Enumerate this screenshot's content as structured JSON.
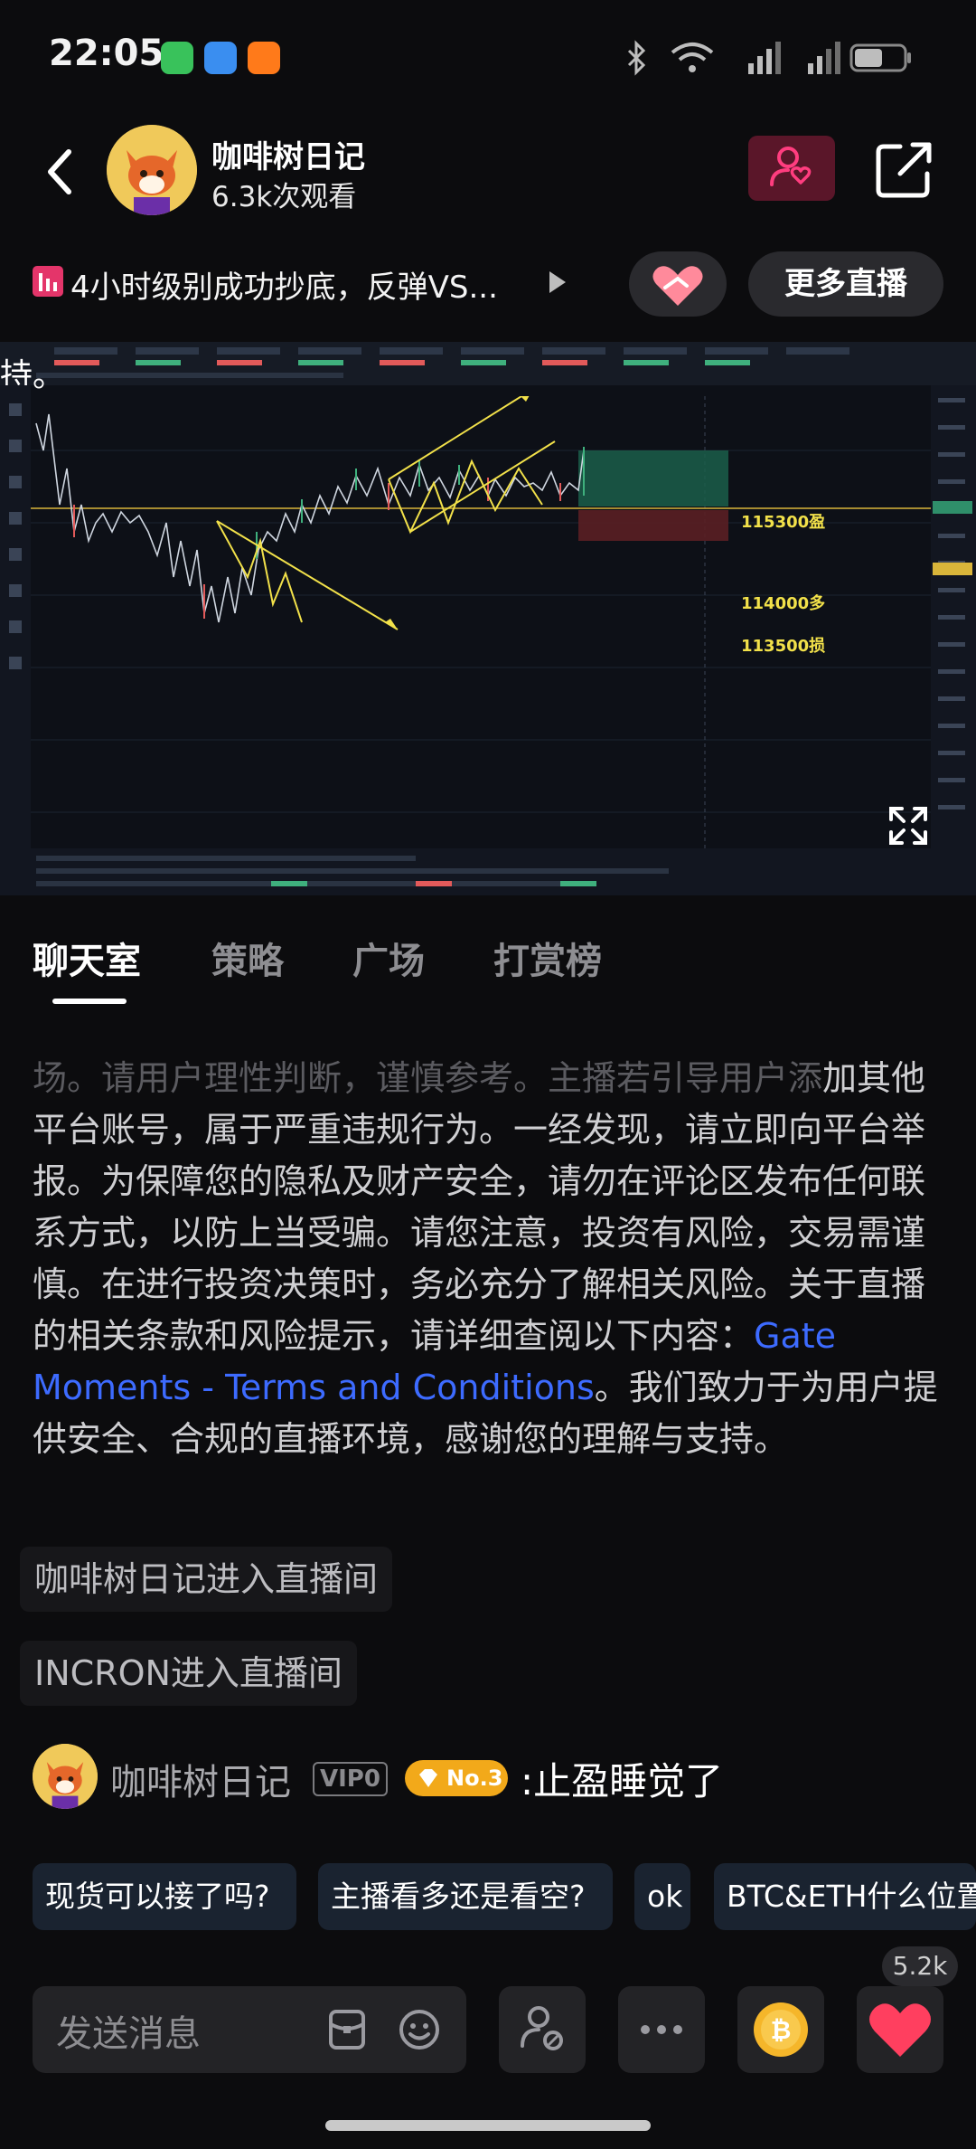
{
  "status": {
    "time": "22:05"
  },
  "header": {
    "host_name": "咖啡树日记",
    "views": "6.3k次观看"
  },
  "title_row": {
    "title": "4小时级别成功抄底，反弹VS...",
    "more_live_label": "更多直播"
  },
  "video": {
    "overlay_text": "持。",
    "price_labels": {
      "take_profit": "115300盈",
      "entry": "114000多",
      "stop_loss": "113500损"
    },
    "colors": {
      "profit_zone": "#1b5e4a",
      "loss_zone": "#5a1f24",
      "annotation": "#f2e14a"
    }
  },
  "tabs": [
    {
      "label": "聊天室"
    },
    {
      "label": "策略"
    },
    {
      "label": "广场"
    },
    {
      "label": "打赏榜"
    }
  ],
  "chat": {
    "notice_fade": "场。请用户理性判断，谨慎参考。主播若引导用户添",
    "notice_body": "加其他平台账号，属于严重违规行为。一经发现，请立即向平台举报。为保障您的隐私及财产安全，请勿在评论区发布任何联系方式，以防上当受骗。请您注意，投资有风险，交易需谨慎。在进行投资决策时，务必充分了解相关风险。关于直播的相关条款和风险提示，请详细查阅以下内容：",
    "notice_link": "Gate Moments - Terms and Conditions",
    "notice_tail": "。我们致力于为用户提供安全、合规的直播环境，感谢您的理解与支持。",
    "system_messages": [
      {
        "text": "咖啡树日记进入直播间"
      },
      {
        "text": "INCRON进入直播间"
      }
    ],
    "message": {
      "user": "咖啡树日记",
      "vip": "VIP0",
      "rank": "No.3",
      "text": ":止盈睡觉了"
    }
  },
  "quick_replies": [
    {
      "label": "现货可以接了吗?"
    },
    {
      "label": "主播看多还是看空?"
    },
    {
      "label": "ok"
    },
    {
      "label": "BTC&ETH什么位置"
    }
  ],
  "bottom_bar": {
    "like_count": "5.2k",
    "input_placeholder": "发送消息"
  },
  "theme": {
    "background": "#0c0c0e",
    "link_color": "#3d6bff",
    "accent_pink": "#e4356a",
    "badge_gold": "#f2a91a"
  }
}
